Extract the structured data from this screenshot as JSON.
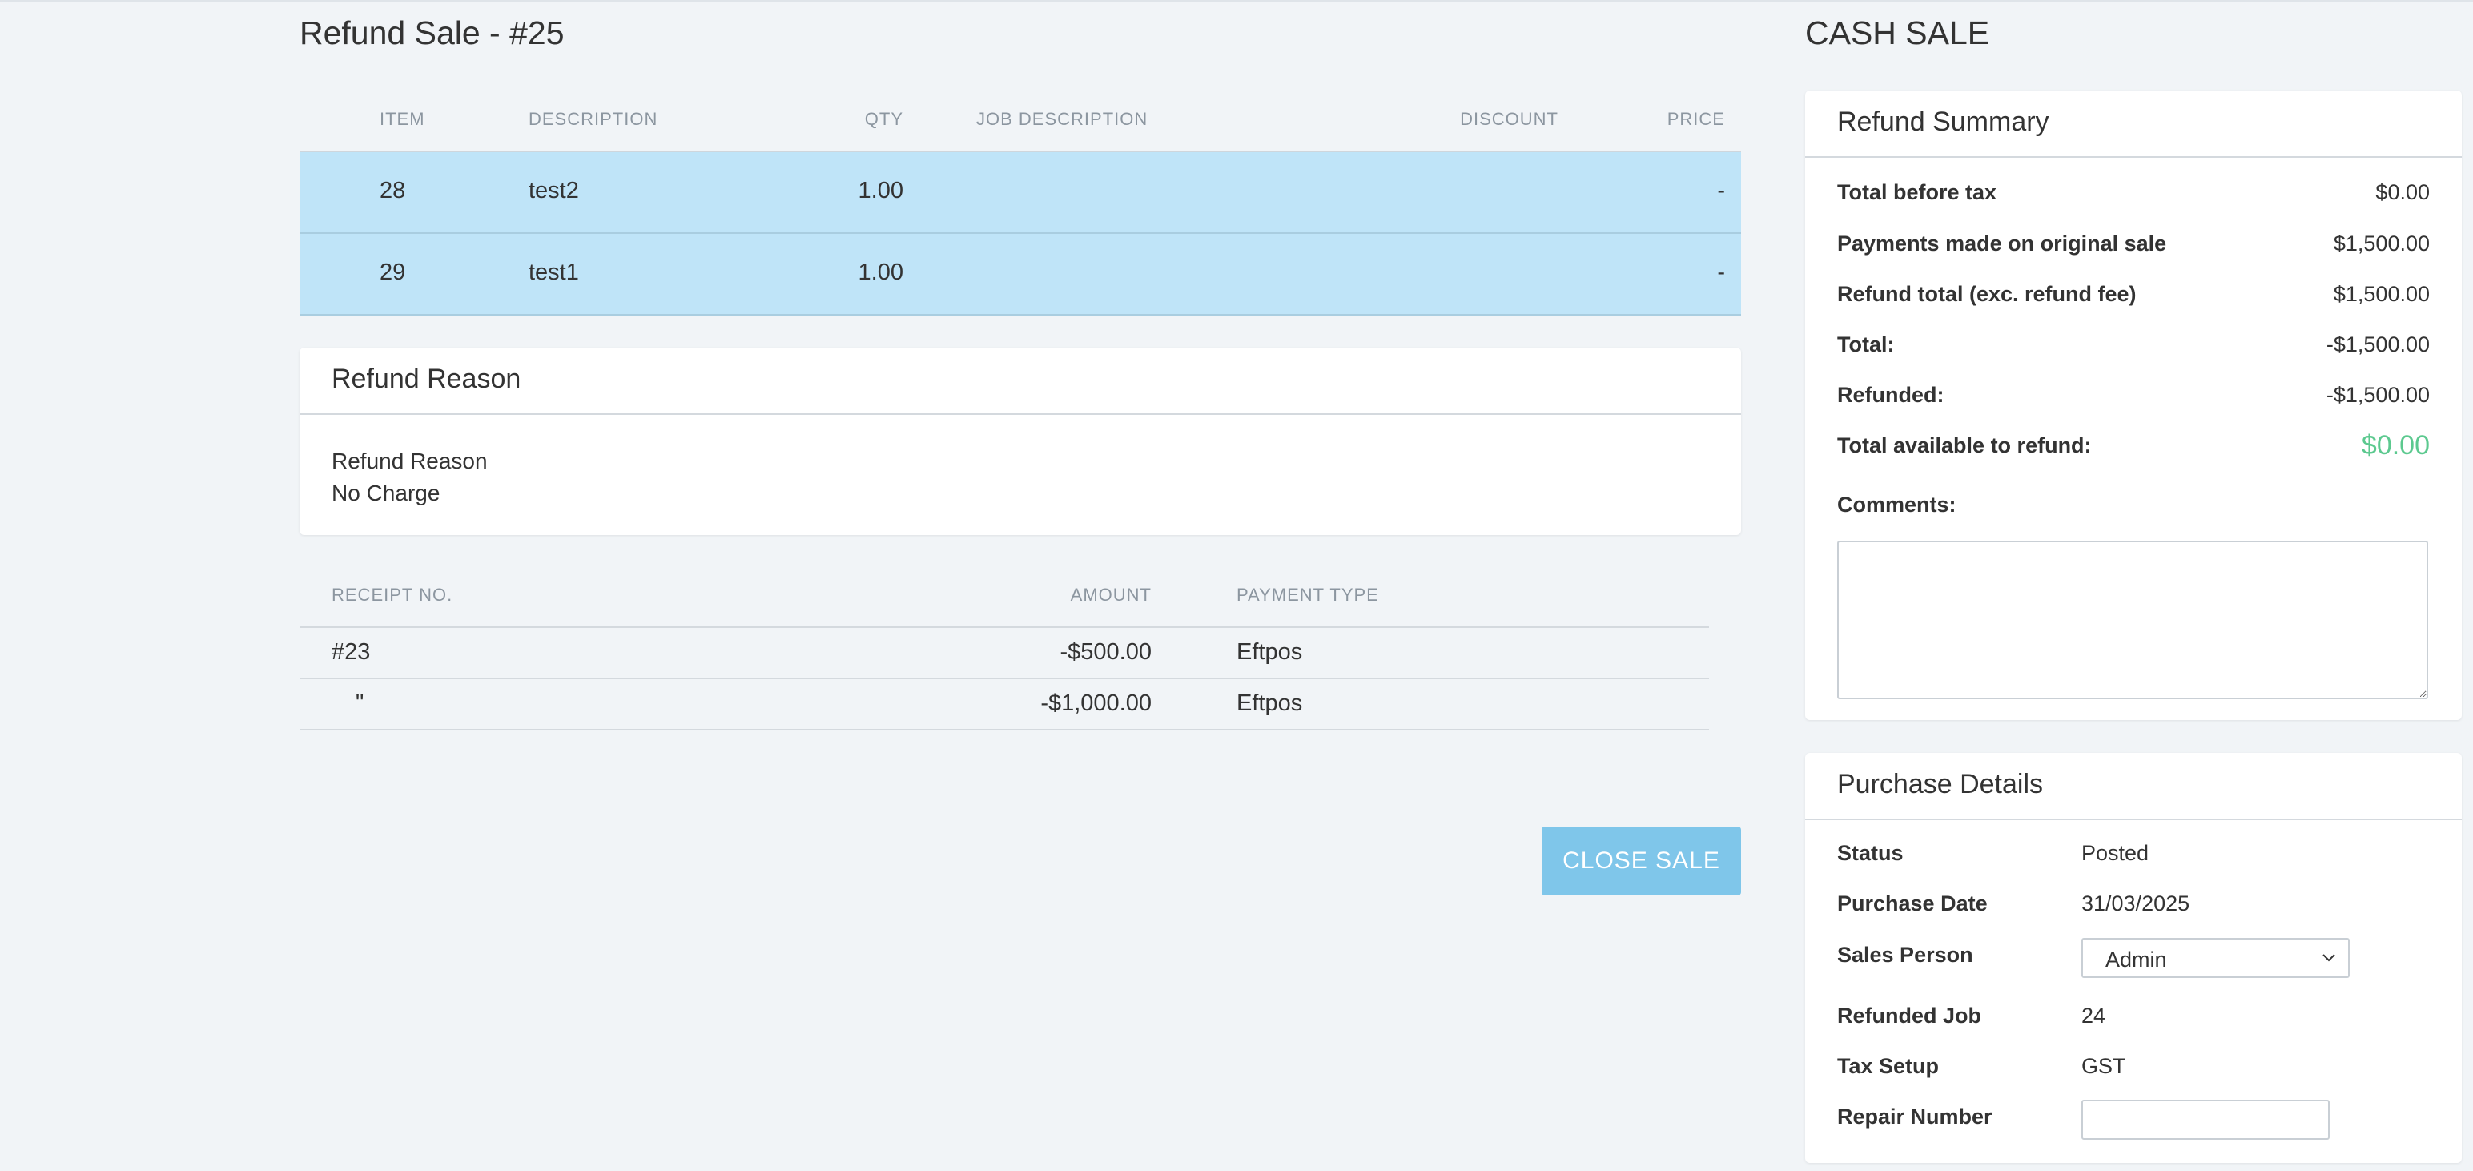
{
  "page": {
    "title": "Refund Sale - #25",
    "sale_type": "CASH SALE"
  },
  "items_table": {
    "headers": {
      "item": "ITEM",
      "description": "DESCRIPTION",
      "qty": "QTY",
      "job_description": "JOB DESCRIPTION",
      "discount": "DISCOUNT",
      "price": "PRICE"
    },
    "rows": [
      {
        "item": "28",
        "description": "test2",
        "qty": "1.00",
        "job_description": "",
        "discount": "",
        "price": "-"
      },
      {
        "item": "29",
        "description": "test1",
        "qty": "1.00",
        "job_description": "",
        "discount": "",
        "price": "-"
      }
    ]
  },
  "refund_reason": {
    "card_title": "Refund Reason",
    "label": "Refund Reason",
    "value": "No Charge"
  },
  "payments_table": {
    "headers": {
      "receipt_no": "RECEIPT NO.",
      "amount": "AMOUNT",
      "payment_type": "PAYMENT TYPE"
    },
    "rows": [
      {
        "receipt_no": "#23",
        "amount": "-$500.00",
        "payment_type": "Eftpos"
      },
      {
        "receipt_no": "\"",
        "amount": "-$1,000.00",
        "payment_type": "Eftpos"
      }
    ]
  },
  "close_button": {
    "label": "CLOSE SALE"
  },
  "refund_summary": {
    "card_title": "Refund Summary",
    "rows": [
      {
        "label": "Total before tax",
        "value": "$0.00"
      },
      {
        "label": "Payments made on original sale",
        "value": "$1,500.00"
      },
      {
        "label": "Refund total (exc. refund fee)",
        "value": "$1,500.00"
      },
      {
        "label": "Total:",
        "value": "-$1,500.00"
      },
      {
        "label": "Refunded:",
        "value": "-$1,500.00"
      },
      {
        "label": "Total available to refund:",
        "value": "$0.00"
      }
    ],
    "comments_label": "Comments:",
    "comments_value": "",
    "highlight_color": "#5cc98f"
  },
  "purchase_details": {
    "card_title": "Purchase Details",
    "status_label": "Status",
    "status_value": "Posted",
    "purchase_date_label": "Purchase Date",
    "purchase_date_value": "31/03/2025",
    "sales_person_label": "Sales Person",
    "sales_person_value": "Admin",
    "refunded_job_label": "Refunded Job",
    "refunded_job_value": "24",
    "tax_setup_label": "Tax Setup",
    "tax_setup_value": "GST",
    "repair_number_label": "Repair Number",
    "repair_number_value": ""
  },
  "colors": {
    "background": "#f1f4f7",
    "selected_row": "#bfe4f8",
    "primary_button": "#7fc6ea"
  },
  "icons": {
    "select_chevron": "chevron-down-icon",
    "textarea_resize": "resize-handle-icon"
  }
}
